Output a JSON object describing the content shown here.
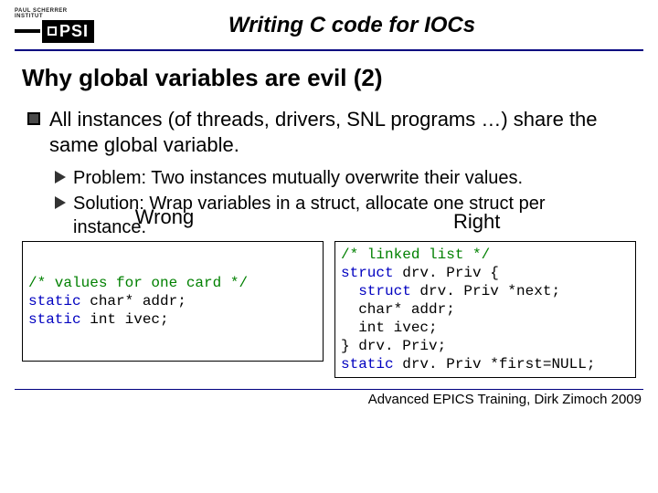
{
  "logo": {
    "institute": "PAUL SCHERRER INSTITUT",
    "text": "PSI"
  },
  "title": "Writing C code for IOCs",
  "subtitle": "Why global variables are evil (2)",
  "bullet": "All instances (of threads, drivers, SNL programs …) share the same global variable.",
  "sub1": "Problem: Two instances mutually overwrite their values.",
  "sub2_a": "Solution: Wrap variables in a struct, allocate one struct per",
  "sub2_b": "instance.",
  "wrong_label": "Wrong",
  "right_label": "Right",
  "code_left": {
    "l1": "/* values for one card */",
    "l2a": "static",
    "l2b": " char* addr;",
    "l3a": "static",
    "l3b": " int ivec;"
  },
  "code_right": {
    "l1": "/* linked list */",
    "l2a": "struct",
    "l2b": " drv. Priv {",
    "l3a": "  struct",
    "l3b": " drv. Priv *next;",
    "l4": "  char* addr;",
    "l5": "  int ivec;",
    "l6": "} drv. Priv;",
    "l7a": "static",
    "l7b": " drv. Priv *first=NULL;"
  },
  "footer": "Advanced EPICS Training, Dirk Zimoch 2009"
}
